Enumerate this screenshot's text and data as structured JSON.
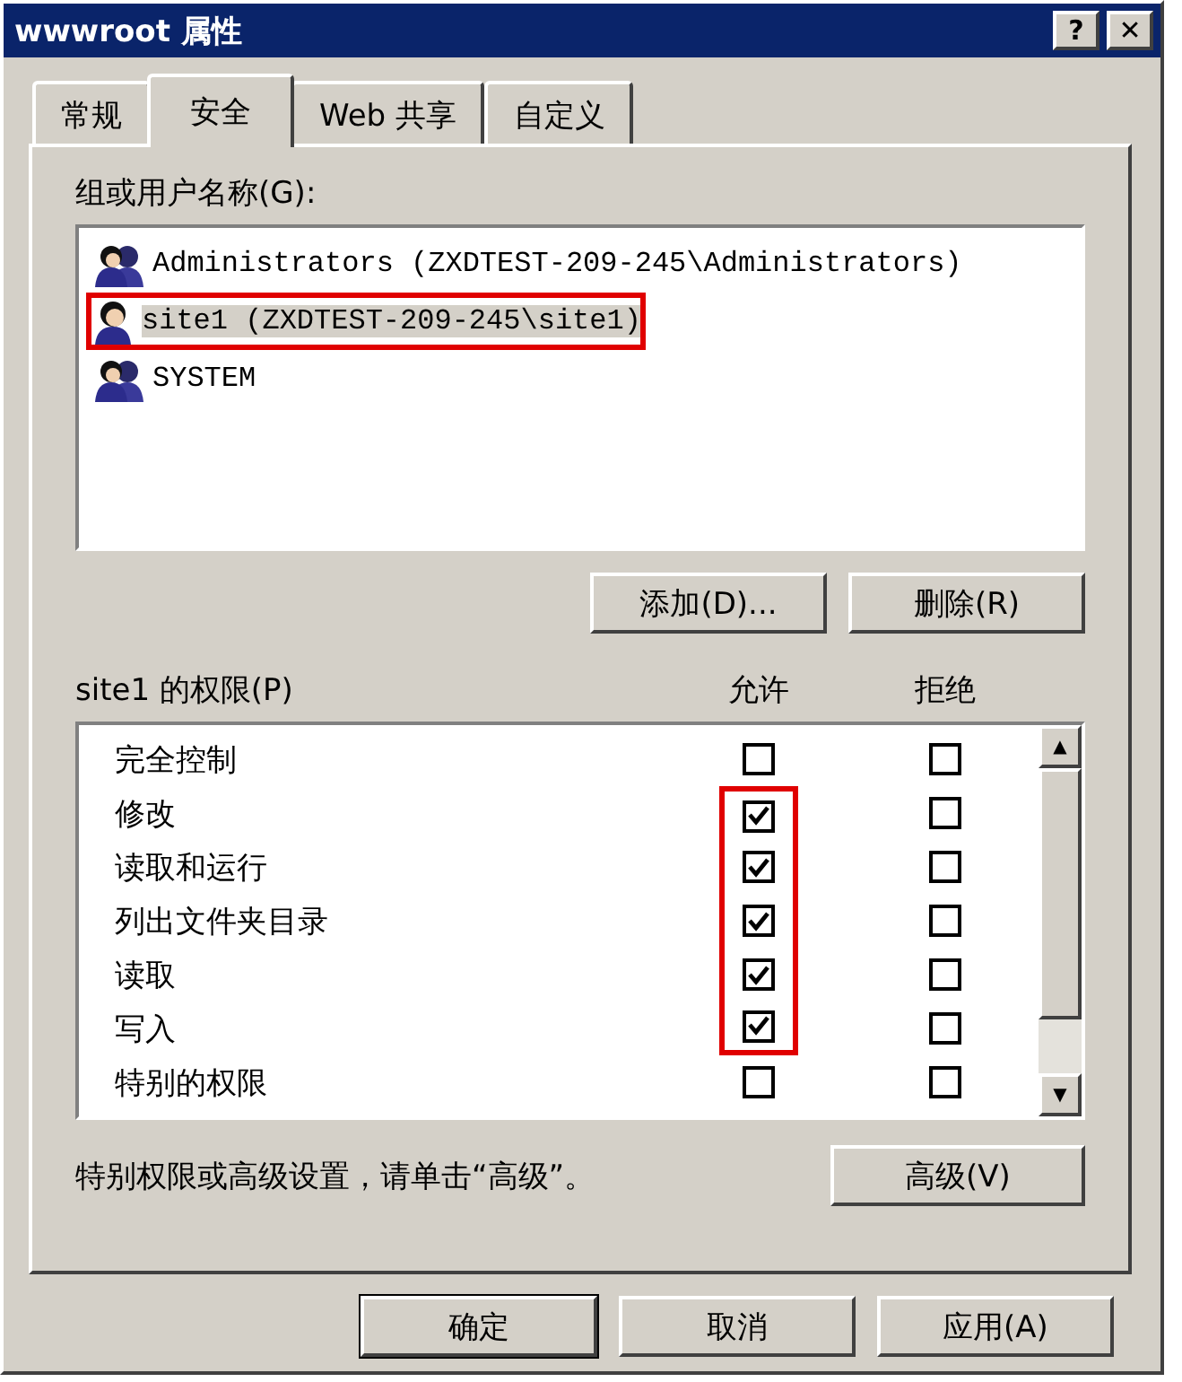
{
  "window": {
    "title": "wwwroot 属性",
    "help": "?",
    "close": "✕"
  },
  "tabs": [
    {
      "label": "常规",
      "selected": false
    },
    {
      "label": "安全",
      "selected": true
    },
    {
      "label": "Web 共享",
      "selected": false
    },
    {
      "label": "自定义",
      "selected": false
    }
  ],
  "users_label": "组或用户名称(G):",
  "users": [
    {
      "name": "Administrators (ZXDTEST-209-245\\Administrators)",
      "kind": "group",
      "selected": false,
      "highlighted": false
    },
    {
      "name": "site1 (ZXDTEST-209-245\\site1)",
      "kind": "user",
      "selected": true,
      "highlighted": true
    },
    {
      "name": "SYSTEM",
      "kind": "group",
      "selected": false,
      "highlighted": false
    }
  ],
  "user_buttons": [
    "添加(D)...",
    "删除(R)"
  ],
  "permissions_label": "site1 的权限(P)",
  "columns": [
    "允许",
    "拒绝"
  ],
  "permissions": [
    {
      "name": "完全控制",
      "allow": false,
      "deny": false,
      "highlighted": false
    },
    {
      "name": "修改",
      "allow": true,
      "deny": false,
      "highlighted": true
    },
    {
      "name": "读取和运行",
      "allow": true,
      "deny": false,
      "highlighted": true
    },
    {
      "name": "列出文件夹目录",
      "allow": true,
      "deny": false,
      "highlighted": true
    },
    {
      "name": "读取",
      "allow": true,
      "deny": false,
      "highlighted": true
    },
    {
      "name": "写入",
      "allow": true,
      "deny": false,
      "highlighted": true
    },
    {
      "name": "特别的权限",
      "allow": false,
      "deny": false,
      "highlighted": false
    }
  ],
  "scrollbar": {
    "up": "▲",
    "down": "▼"
  },
  "advanced_hint": "特别权限或高级设置，请单击“高级”。",
  "advanced_button": "高级(V)",
  "dialog_buttons": [
    {
      "label": "确定",
      "default": true
    },
    {
      "label": "取消",
      "default": false
    },
    {
      "label": "应用(A)",
      "default": false
    }
  ]
}
